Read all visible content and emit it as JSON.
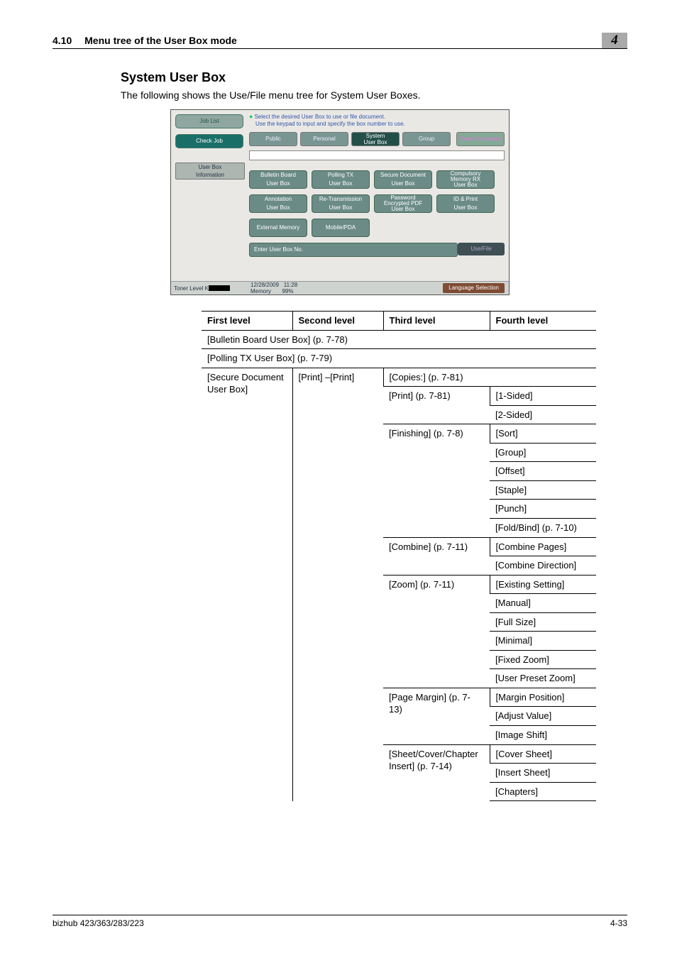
{
  "header": {
    "section_num": "4.10",
    "section_title": "Menu tree of the User Box mode",
    "chapter_num": "4"
  },
  "heading": "System User Box",
  "intro": "The following shows the Use/File menu tree for System User Boxes.",
  "screenshot": {
    "side": {
      "job_list": "Job List",
      "check_job": "Check Job",
      "user_box_info": "User Box\nInformation"
    },
    "hint_l1": "Select the desired User Box to use or file document.",
    "hint_l2": "Use the keypad to input and specify the box number to use.",
    "tabs": {
      "public": "Public",
      "personal": "Personal",
      "system": "System\nUser Box",
      "group": "Group",
      "save": "Save Document"
    },
    "grid": {
      "r1": [
        "Bulletin Board\nUser Box",
        "Polling TX\nUser Box",
        "Secure Document\nUser Box",
        "Compulsory\nMemory RX\nUser Box"
      ],
      "r2": [
        "Annotation\nUser Box",
        "Re-Transmission\nUser Box",
        "Password\nEncrypted PDF\nUser Box",
        "ID & Print\nUser Box"
      ],
      "r3": [
        "External Memory",
        "Mobile/PDA"
      ]
    },
    "enter_label": "Enter User Box No.",
    "usefile": "Use/File",
    "footer": {
      "toner": "Toner Level",
      "date": "12/28/2009",
      "time": "11:28",
      "memory": "Memory",
      "memval": "99%",
      "lang": "Language Selection"
    }
  },
  "table": {
    "headers": {
      "c1": "First level",
      "c2": "Second level",
      "c3": "Third level",
      "c4": "Fourth level"
    },
    "span1": "[Bulletin Board User Box] (p. 7-78)",
    "span2": "[Polling TX User Box] (p. 7-79)",
    "first": "[Secure Document User Box]",
    "second": "[Print] –[Print]",
    "rows": [
      {
        "l3": "[Copies:] (p. 7-81)",
        "l4span": true
      },
      {
        "l3": "[Print] (p. 7-81)",
        "l4": "[1-Sided]"
      },
      {
        "l4": "[2-Sided]"
      },
      {
        "l3": "[Finishing] (p. 7-8)",
        "l4": "[Sort]"
      },
      {
        "l4": "[Group]"
      },
      {
        "l4": "[Offset]"
      },
      {
        "l4": "[Staple]"
      },
      {
        "l4": "[Punch]"
      },
      {
        "l4": "[Fold/Bind] (p. 7-10)"
      },
      {
        "l3": "[Combine] (p. 7-11)",
        "l4": "[Combine Pages]"
      },
      {
        "l4": "[Combine Direction]"
      },
      {
        "l3": "[Zoom] (p. 7-11)",
        "l4": "[Existing Setting]"
      },
      {
        "l4": "[Manual]"
      },
      {
        "l4": "[Full Size]"
      },
      {
        "l4": "[Minimal]"
      },
      {
        "l4": "[Fixed Zoom]"
      },
      {
        "l4": "[User Preset Zoom]"
      },
      {
        "l3": "[Page Margin] (p. 7-13)",
        "l4": "[Margin Position]"
      },
      {
        "l4": "[Adjust Value]"
      },
      {
        "l4": "[Image Shift]"
      },
      {
        "l3": "[Sheet/Cover/Chapter Insert] (p. 7-14)",
        "l4": "[Cover Sheet]"
      },
      {
        "l4": "[Insert Sheet]"
      },
      {
        "l4": "[Chapters]"
      }
    ]
  },
  "footer": {
    "left": "bizhub 423/363/283/223",
    "right": "4-33"
  }
}
